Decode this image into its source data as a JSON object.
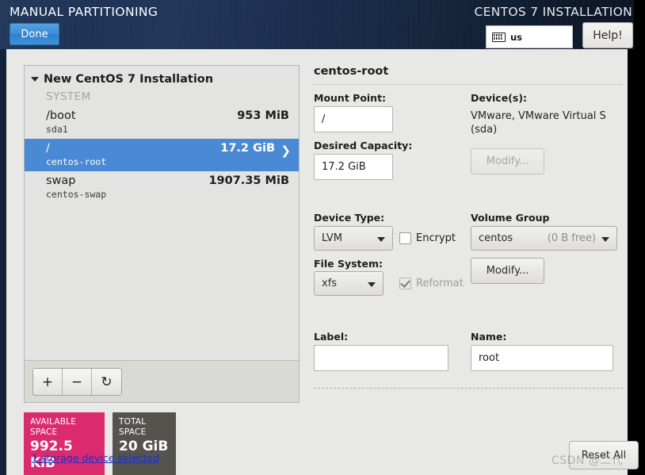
{
  "header": {
    "title": "MANUAL PARTITIONING",
    "product_title": "CENTOS 7 INSTALLATION",
    "done_label": "Done",
    "help_label": "Help!",
    "keyboard_layout": "us",
    "keyboard_icon": "keyboard-icon"
  },
  "partition_panel": {
    "group_title": "New CentOS 7 Installation",
    "group_collapse_icon": "triangle-down-icon",
    "section_label": "SYSTEM",
    "rows": [
      {
        "mount": "/boot",
        "device": "sda1",
        "size": "953 MiB",
        "selected": false
      },
      {
        "mount": "/",
        "device": "centos-root",
        "size": "17.2 GiB",
        "selected": true
      },
      {
        "mount": "swap",
        "device": "centos-swap",
        "size": "1907.35 MiB",
        "selected": false
      }
    ],
    "selected_chevron_icon": "chevron-right-icon",
    "toolbar": {
      "add_label": "+",
      "remove_label": "−",
      "refresh_label": "↻",
      "add_icon": "plus-icon",
      "remove_icon": "minus-icon",
      "refresh_icon": "refresh-icon"
    }
  },
  "space_summary": {
    "available_label": "AVAILABLE SPACE",
    "available_value": "992.5 KiB",
    "available_color": "#dc2a6e",
    "total_label": "TOTAL SPACE",
    "total_value": "20 GiB",
    "total_color": "#55534e"
  },
  "storage_link": "1 storage device selected",
  "detail": {
    "title": "centos-root",
    "mount_point_label": "Mount Point:",
    "mount_point_value": "/",
    "desired_capacity_label": "Desired Capacity:",
    "desired_capacity_value": "17.2 GiB",
    "devices_label": "Device(s):",
    "devices_value": "VMware, VMware Virtual S (sda)",
    "device_modify_label": "Modify...",
    "device_type_label": "Device Type:",
    "device_type_value": "LVM",
    "encrypt_label": "Encrypt",
    "encrypt_checked": false,
    "file_system_label": "File System:",
    "file_system_value": "xfs",
    "reformat_label": "Reformat",
    "reformat_checked": true,
    "volume_group_label": "Volume Group",
    "volume_group_value": "centos",
    "volume_group_free": "(0 B free)",
    "volume_group_modify_label": "Modify...",
    "label_label": "Label:",
    "label_value": "",
    "name_label": "Name:",
    "name_value": "root"
  },
  "reset_all_label": "Reset All",
  "watermark": "CSDN @二代",
  "colors": {
    "header_bg": "#16273f",
    "selection_blue": "#4a8ad4",
    "done_blue": "#3d8fd6",
    "page_bg": "#e8e8e6",
    "link_blue": "#1a31c8"
  }
}
